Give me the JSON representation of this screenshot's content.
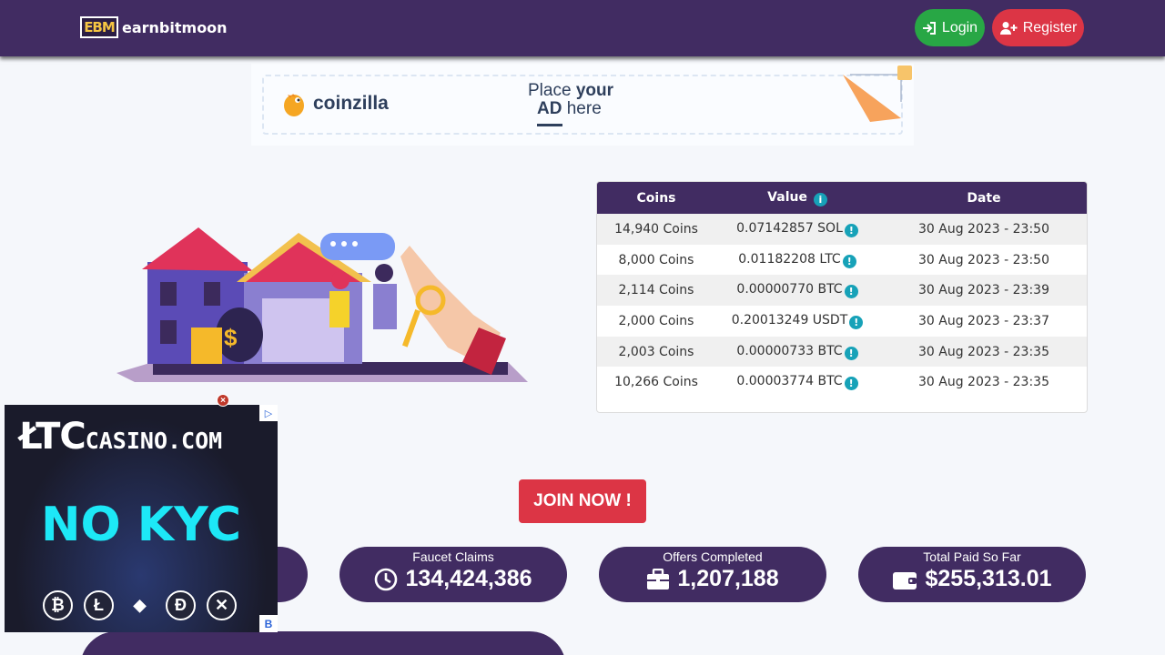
{
  "nav": {
    "logo_mark": "EBM",
    "brand": "earnbitmoon",
    "login_label": "Login",
    "register_label": "Register"
  },
  "ad_banner": {
    "brand": "coinzilla",
    "place_line1_a": "Place ",
    "place_line1_b": "your",
    "place_line2_a": "AD",
    "place_line2_b": " here"
  },
  "payouts": {
    "headers": [
      "Coins",
      "Value",
      "Date"
    ],
    "rows": [
      {
        "coins": "14,940 Coins",
        "value": "0.07142857 SOL",
        "date": "30 Aug 2023 - 23:50"
      },
      {
        "coins": "8,000 Coins",
        "value": "0.01182208 LTC",
        "date": "30 Aug 2023 - 23:50"
      },
      {
        "coins": "2,114 Coins",
        "value": "0.00000770 BTC",
        "date": "30 Aug 2023 - 23:39"
      },
      {
        "coins": "2,000 Coins",
        "value": "0.20013249 USDT",
        "date": "30 Aug 2023 - 23:37"
      },
      {
        "coins": "2,003 Coins",
        "value": "0.00000733 BTC",
        "date": "30 Aug 2023 - 23:35"
      },
      {
        "coins": "10,266 Coins",
        "value": "0.00003774 BTC",
        "date": "30 Aug 2023 - 23:35"
      }
    ]
  },
  "join_label": "JOIN NOW !",
  "stats": [
    {
      "label": "Faucet Claims",
      "value": "134,424,386",
      "icon": "clock-icon"
    },
    {
      "label": "Offers Completed",
      "value": "1,207,188",
      "icon": "briefcase-icon"
    },
    {
      "label": "Total Paid So Far",
      "value": "$255,313.01",
      "icon": "wallet-icon"
    }
  ],
  "float_ad": {
    "title_main": "ŁTC",
    "title_suffix": "CASINO.COM",
    "headline": "NO KYC",
    "coins": [
      "₿",
      "Ł",
      "◆",
      "Đ",
      "✕"
    ]
  },
  "colors": {
    "primary": "#412c62",
    "success": "#28a745",
    "danger": "#dc3545",
    "info": "#17a2b8"
  }
}
